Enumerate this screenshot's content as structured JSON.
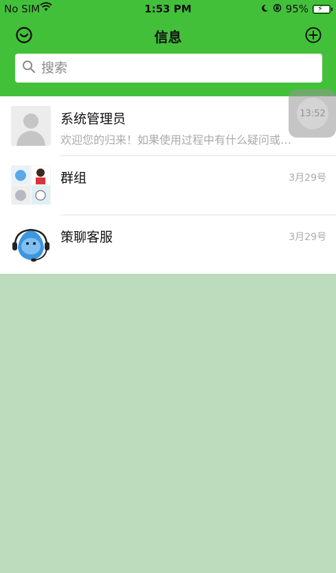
{
  "status_bar": {
    "carrier": "No SIM",
    "time": "1:53 PM",
    "battery": "95%"
  },
  "nav": {
    "title": "信息"
  },
  "search": {
    "placeholder": "搜索"
  },
  "conversations": [
    {
      "name": "系统管理员",
      "preview": "欢迎您的归来！如果使用过程中有什么疑问或…",
      "time": ""
    },
    {
      "name": "群组",
      "preview": "",
      "time": "3月29号"
    },
    {
      "name": "策聊客服",
      "preview": "",
      "time": "3月29号"
    }
  ],
  "floating_button": {
    "label": "13:52"
  },
  "colors": {
    "header": "#43c03a",
    "background": "#bddcbd"
  }
}
